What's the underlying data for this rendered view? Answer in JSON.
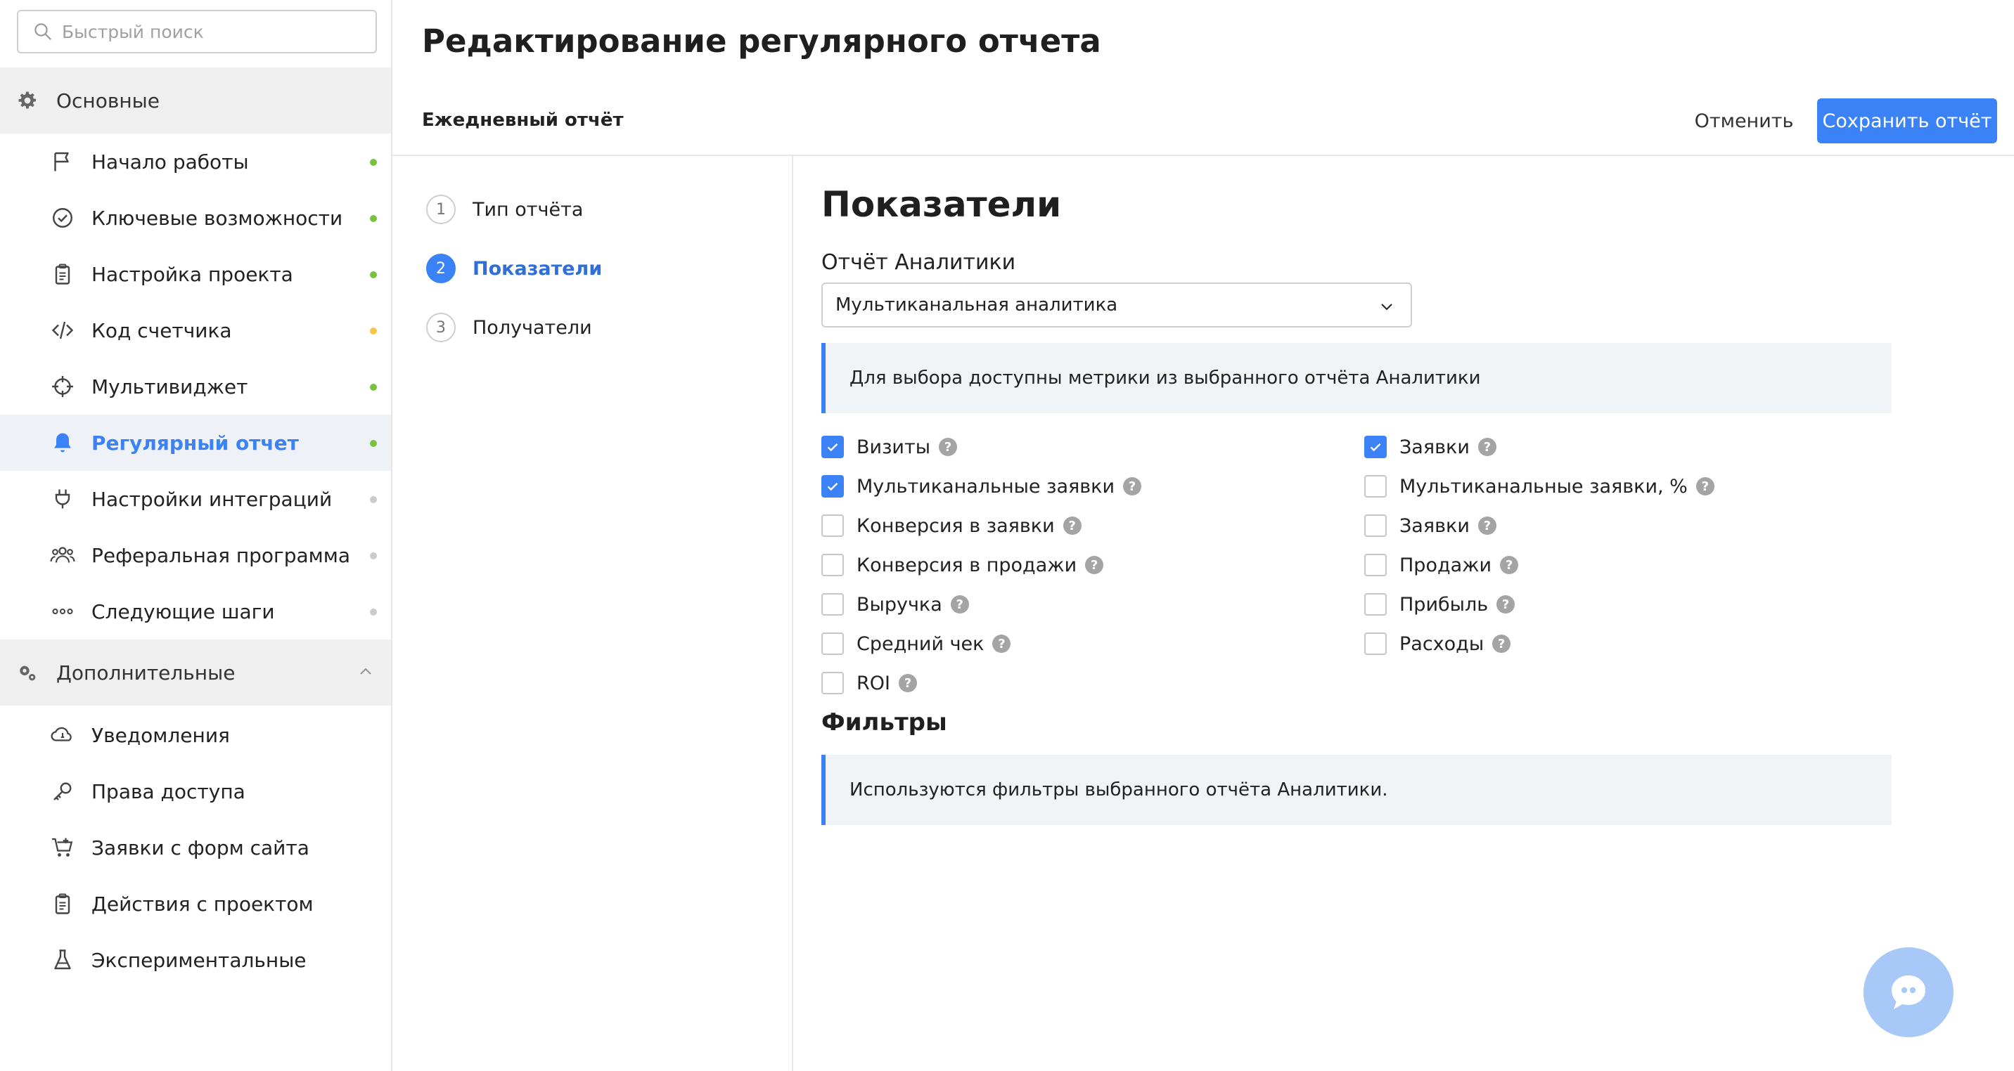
{
  "search": {
    "placeholder": "Быстрый поиск"
  },
  "sidebar": {
    "main_section": {
      "label": "Основные",
      "icon": "gear-icon"
    },
    "main_items": [
      {
        "label": "Начало работы",
        "icon": "flag-icon",
        "dot": "#7ac142"
      },
      {
        "label": "Ключевые возможности",
        "icon": "check-circle-icon",
        "dot": "#7ac142"
      },
      {
        "label": "Настройка проекта",
        "icon": "clipboard-icon",
        "dot": "#7ac142"
      },
      {
        "label": "Код счетчика",
        "icon": "code-icon",
        "dot": "#f5c64a"
      },
      {
        "label": "Мультивиджет",
        "icon": "crosshair-icon",
        "dot": "#7ac142"
      },
      {
        "label": "Регулярный отчет",
        "icon": "bell-icon",
        "dot": "#7ac142",
        "active": true
      },
      {
        "label": "Настройки интеграций",
        "icon": "plug-icon",
        "dot": "#cccccc"
      },
      {
        "label": "Реферальная программа",
        "icon": "users-icon",
        "dot": "#cccccc"
      },
      {
        "label": "Следующие шаги",
        "icon": "dots-icon",
        "dot": "#cccccc"
      }
    ],
    "extra_section": {
      "label": "Дополнительные",
      "icon": "gears-icon"
    },
    "extra_items": [
      {
        "label": "Уведомления",
        "icon": "cloud-bell-icon"
      },
      {
        "label": "Права доступа",
        "icon": "key-icon"
      },
      {
        "label": "Заявки с форм сайта",
        "icon": "cart-icon"
      },
      {
        "label": "Действия с проектом",
        "icon": "clipboard-icon"
      },
      {
        "label": "Экспериментальные",
        "icon": "flask-icon"
      }
    ]
  },
  "header": {
    "title": "Редактирование регулярного отчета",
    "report_name": "Ежедневный отчёт",
    "cancel_label": "Отменить",
    "save_label": "Сохранить отчёт"
  },
  "steps": [
    {
      "num": "1",
      "label": "Тип отчёта",
      "active": false
    },
    {
      "num": "2",
      "label": "Показатели",
      "active": true
    },
    {
      "num": "3",
      "label": "Получатели",
      "active": false
    }
  ],
  "content": {
    "title": "Показатели",
    "report_label": "Отчёт Аналитики",
    "report_value": "Мультиканальная аналитика",
    "metrics_note": "Для выбора доступны метрики из выбранного отчёта Аналитики",
    "filters_title": "Фильтры",
    "filters_note": "Используются фильтры выбранного отчёта Аналитики."
  },
  "metrics_left": [
    {
      "label": "Визиты",
      "checked": true
    },
    {
      "label": "Мультиканальные заявки",
      "checked": true
    },
    {
      "label": "Конверсия в заявки",
      "checked": false
    },
    {
      "label": "Конверсия в продажи",
      "checked": false
    },
    {
      "label": "Выручка",
      "checked": false
    },
    {
      "label": "Средний чек",
      "checked": false
    },
    {
      "label": "ROI",
      "checked": false
    }
  ],
  "metrics_right": [
    {
      "label": "Заявки",
      "checked": true
    },
    {
      "label": "Мультиканальные заявки, %",
      "checked": false
    },
    {
      "label": "Заявки",
      "checked": false
    },
    {
      "label": "Продажи",
      "checked": false
    },
    {
      "label": "Прибыль",
      "checked": false
    },
    {
      "label": "Расходы",
      "checked": false
    }
  ],
  "help_glyph": "?",
  "colors": {
    "accent": "#3b82f6",
    "dot_green": "#7ac142",
    "dot_yellow": "#f5c64a",
    "dot_grey": "#cccccc",
    "note_bg": "#f1f4f7"
  }
}
